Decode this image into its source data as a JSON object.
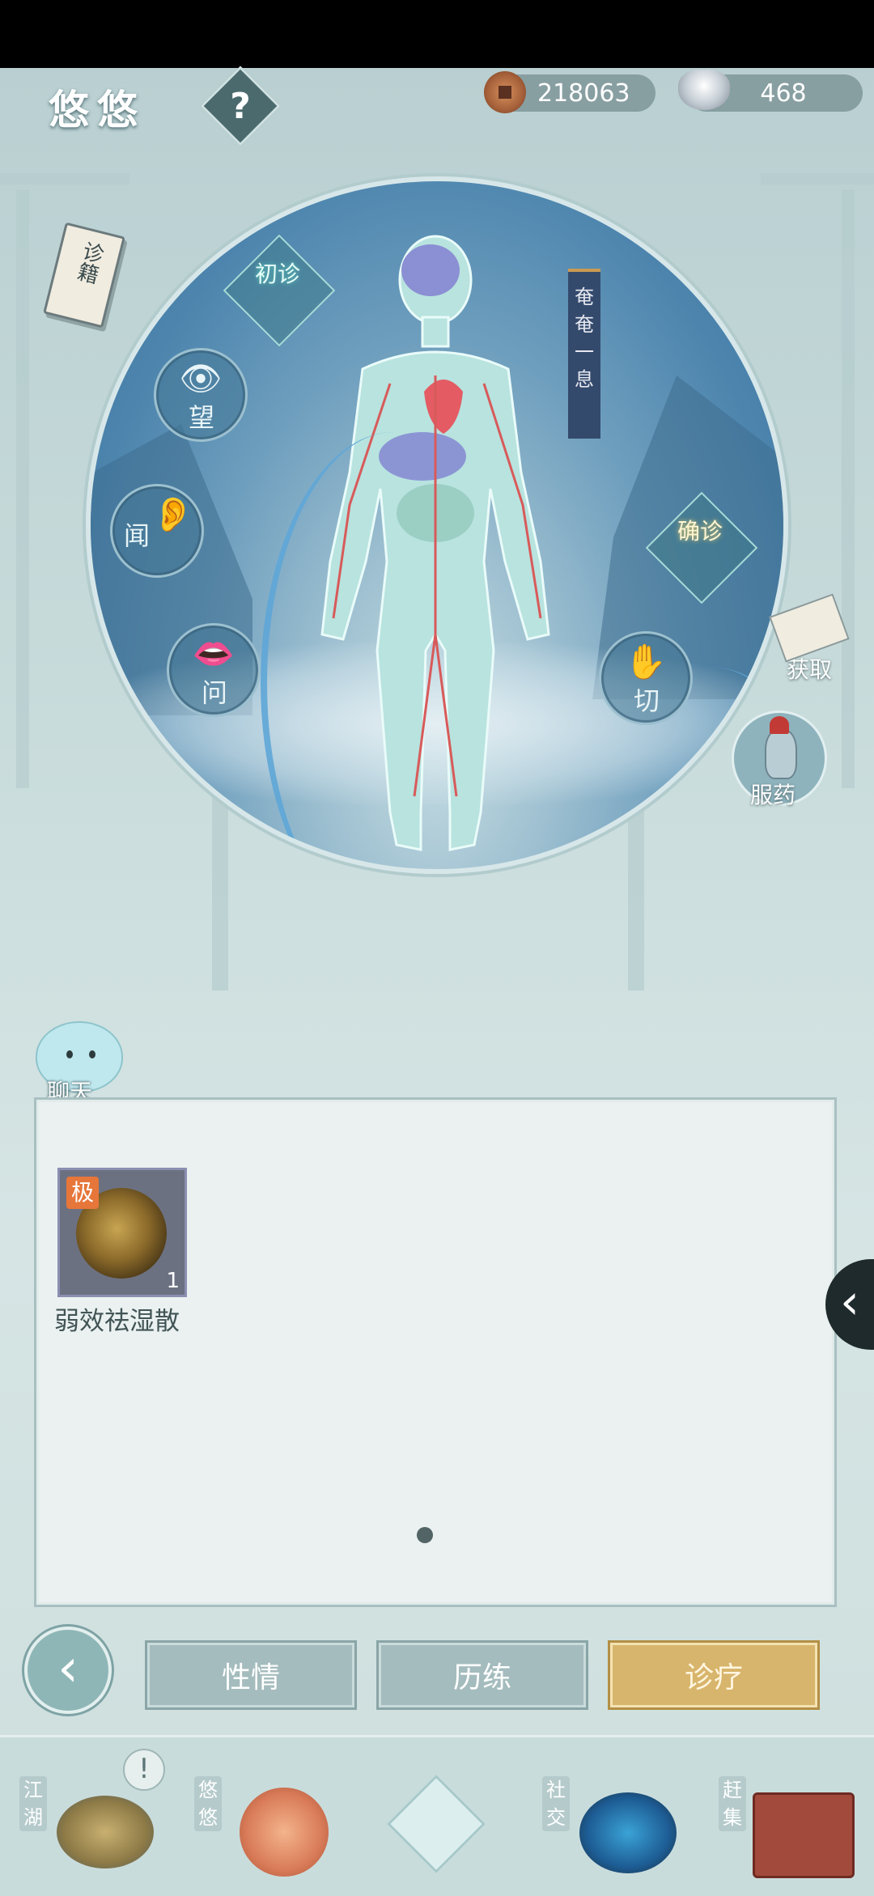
{
  "header": {
    "title": "悠悠",
    "help_label": "?",
    "coins": "218063",
    "silver": "468"
  },
  "scene": {
    "book_label": "诊籍",
    "initial_diagnosis": "初诊",
    "confirm_diagnosis": "确诊",
    "status_banner": "奄奄一息",
    "methods": {
      "look": "望",
      "listen": "闻",
      "ask": "问",
      "pulse": "切"
    },
    "obtain_label": "获取",
    "take_medicine_label": "服药"
  },
  "chat": {
    "label": "聊天"
  },
  "inventory": {
    "items": [
      {
        "badge": "极",
        "count": "1",
        "name": "弱效祛湿散"
      }
    ]
  },
  "tabs": [
    {
      "label": "性情",
      "active": false
    },
    {
      "label": "历练",
      "active": false
    },
    {
      "label": "诊疗",
      "active": true
    }
  ],
  "bottom_nav": [
    {
      "label": "江湖"
    },
    {
      "label": "悠悠"
    },
    {
      "label": "社交"
    },
    {
      "label": "赶集"
    }
  ],
  "colors": {
    "active_tab": "#d8b56c",
    "circle_blue": "#4c84ad",
    "panel_bg": "#eaf1f0"
  }
}
